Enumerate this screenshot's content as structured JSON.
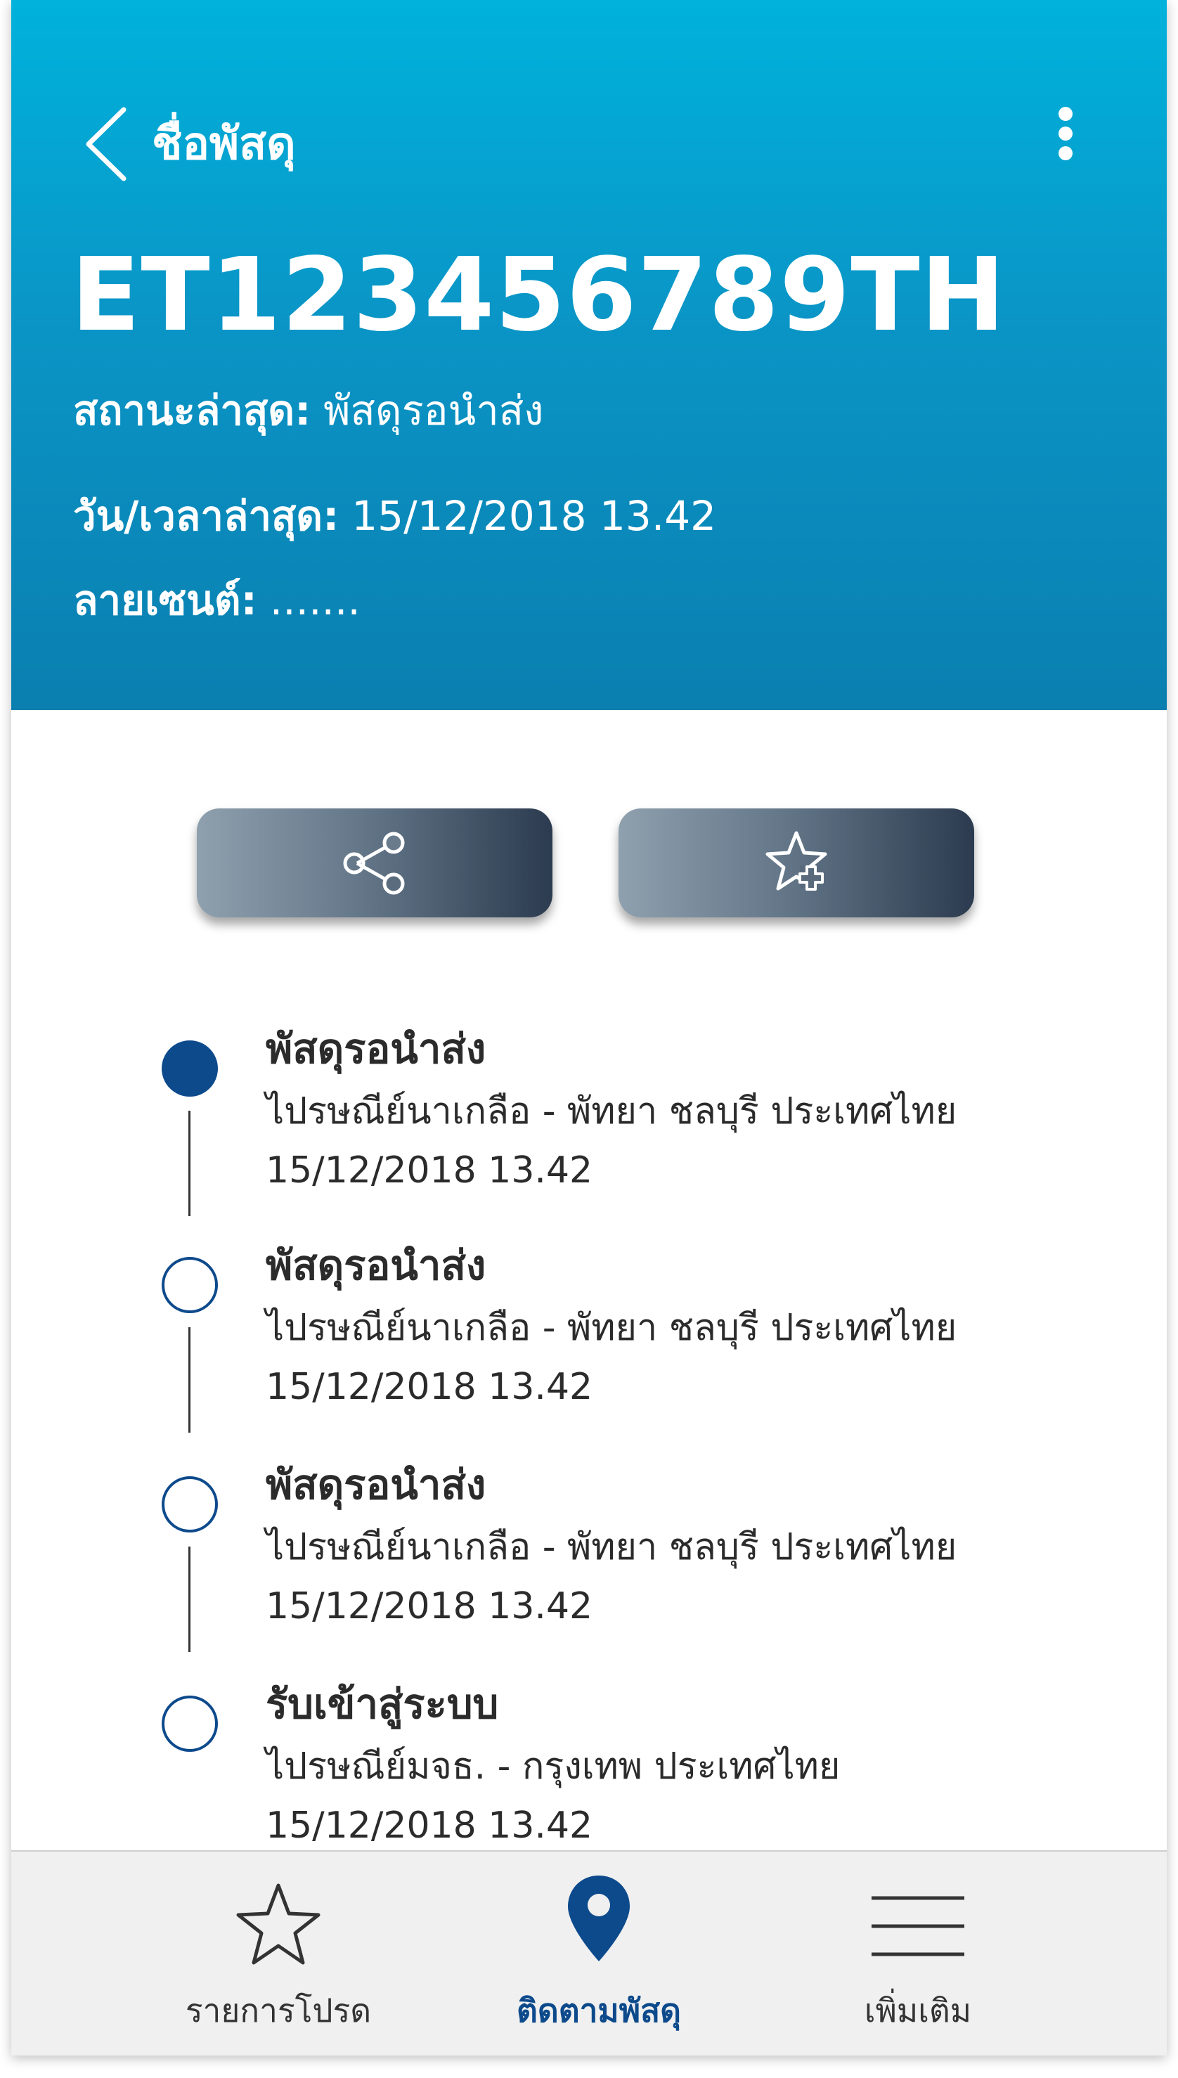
{
  "header": {
    "back_label": "ชื่อพัสดุ",
    "tracking_number": "ET123456789TH",
    "status_label": "สถานะล่าสุด:",
    "status_value": "พัสดุรอนำส่ง",
    "time_label": "วัน/เวลาล่าสุด:",
    "time_value": "15/12/2018 13.42",
    "signature_label": "ลายเซนต์:",
    "signature_value": "......."
  },
  "actions": {
    "share_icon": "share-icon",
    "favorite_icon": "star-add-icon"
  },
  "timeline": [
    {
      "title": "พัสดุรอนำส่ง",
      "location": "ไปรษณีย์นาเกลือ - พัทยา ชลบุรี ประเทศไทย",
      "date": "15/12/2018 13.42",
      "active": true
    },
    {
      "title": "พัสดุรอนำส่ง",
      "location": "ไปรษณีย์นาเกลือ - พัทยา ชลบุรี ประเทศไทย",
      "date": "15/12/2018 13.42",
      "active": false
    },
    {
      "title": "พัสดุรอนำส่ง",
      "location": "ไปรษณีย์นาเกลือ - พัทยา ชลบุรี ประเทศไทย",
      "date": "15/12/2018 13.42",
      "active": false
    },
    {
      "title": "รับเข้าสู่ระบบ",
      "location": "ไปรษณีย์มจธ. - กรุงเทพ ประเทศไทย",
      "date": "15/12/2018 13.42",
      "active": false
    }
  ],
  "bottom_nav": {
    "items": [
      {
        "label": "รายการโปรด",
        "icon": "star-icon",
        "active": false
      },
      {
        "label": "ติดตามพัสดุ",
        "icon": "location-pin-icon",
        "active": true
      },
      {
        "label": "เพิ่มเติม",
        "icon": "menu-icon",
        "active": false
      }
    ]
  },
  "colors": {
    "header_top": "#00b2dc",
    "header_bottom": "#0a7fb0",
    "accent": "#0d4a8c",
    "button_dark": "#2c3b4f",
    "nav_background": "#f0f0f0"
  }
}
